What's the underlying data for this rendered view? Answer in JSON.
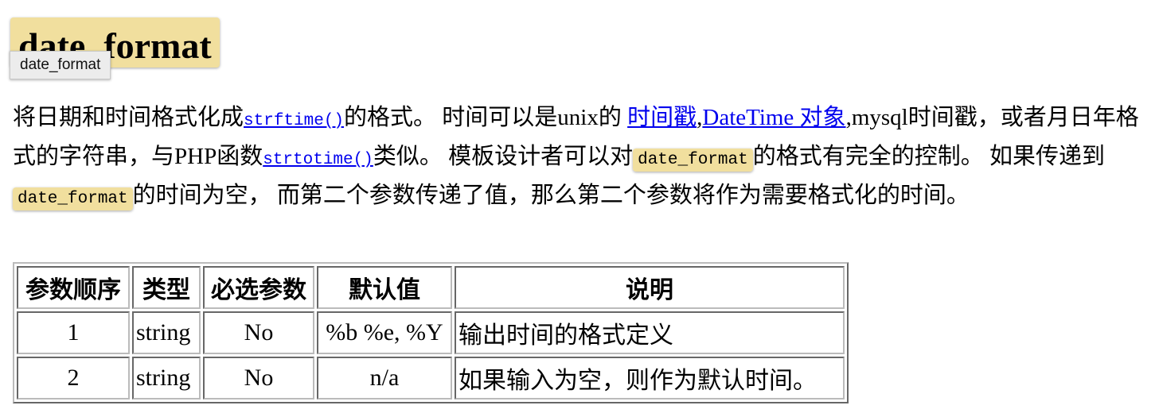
{
  "heading": {
    "title": "date_format",
    "tooltip": "date_format"
  },
  "description": {
    "t1": "将日期和时间格式化成",
    "link_strftime": "strftime()",
    "t2": "的格式。 时间可以是unix的 ",
    "link_timestamp": "时间戳",
    "t3": ",",
    "link_datetime": "DateTime 对象",
    "t4": ",mysql时间戳，或者月日年格式的字符串，与PHP函数",
    "link_strtotime": "strtotime()",
    "t5": "类似。 模板设计者可以对",
    "code1": "date_format",
    "t6": "的格式有完全的控制。 如果传递到",
    "code2": "date_format",
    "t7": "的时间为空， 而第二个参数传递了值，那么第二个参数将作为需要格式化的时间。"
  },
  "table": {
    "headers": [
      "参数顺序",
      "类型",
      "必选参数",
      "默认值",
      "说明"
    ],
    "rows": [
      [
        "1",
        "string",
        "No",
        "%b %e, %Y",
        "输出时间的格式定义"
      ],
      [
        "2",
        "string",
        "No",
        "n/a",
        "如果输入为空，则作为默认时间。"
      ]
    ]
  }
}
